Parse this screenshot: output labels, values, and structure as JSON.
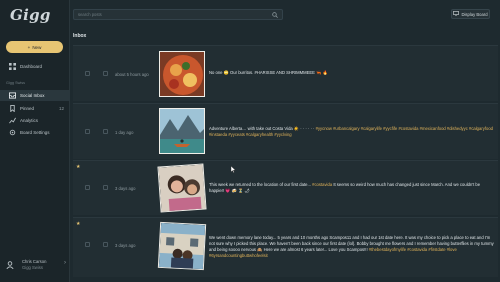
{
  "app": {
    "logo": "Gigg"
  },
  "sidebar": {
    "new_label": "New",
    "dashboard": "Dashboard",
    "section": "Gigg Swiss",
    "items": [
      {
        "label": "Social Inbox",
        "icon": "inbox-icon"
      },
      {
        "label": "Pinned",
        "count": "12",
        "icon": "pin-icon"
      },
      {
        "label": "Analytics",
        "icon": "analytics-icon"
      },
      {
        "label": "Board Settings",
        "icon": "gear-icon"
      }
    ],
    "user": {
      "name": "Chris Carson",
      "org": "Gigg Swiss"
    }
  },
  "topbar": {
    "search_placeholder": "search posts",
    "display_board": "Display Board"
  },
  "main": {
    "title": "Inbox",
    "posts": [
      {
        "time": "about 5 hours ago",
        "starred": false,
        "text_plain": "No one 🙄 Our burritos. #HARISSE AND SHRIMMMEEE 🦐 🔥",
        "tags": ""
      },
      {
        "time": "1 day ago",
        "starred": false,
        "text_plain": "Adventure Alberta… with take out Costa Vida ☀️ · · · · · · ",
        "tags": "#yycnow #urbancalgary #calgarylife #yycfife #costavida #mexicanfood #dishedyyc #calgaryfood #instaeda #yyceats #calgaryhealth #yyclving"
      },
      {
        "time": "3 days ago",
        "starred": true,
        "text_plain": "This week we returned to the location of our first date... ",
        "tag_inline": "#costavida",
        "text_after": " It seems so weird how much has changed just since March. And we couldn't be happier! 💗 🍻 ⏳ 🌶",
        "tags": ""
      },
      {
        "time": "3 days ago",
        "starred": true,
        "text_plain": "We went down memory lane today... 5 years and 10 months ago Scampos11 and I had our 1st date here. It was my choice to pick a place to eat and I'm not sure why I picked this place. We haven't been back since our first date (lol). Bobby brought me flowers and I remember having butterflies in my tummy and being soooo nervous 🙈 Here we are almost 6 years later... Love you Scampos!!! ",
        "tags": "#thebestdayofmylife #costavida #firstdate #love #6yrsandcountingbuttwhofeelsit"
      }
    ]
  },
  "colors": {
    "accent": "#e7c573",
    "tag": "#e0b35a",
    "background": "#1e2a2f"
  }
}
